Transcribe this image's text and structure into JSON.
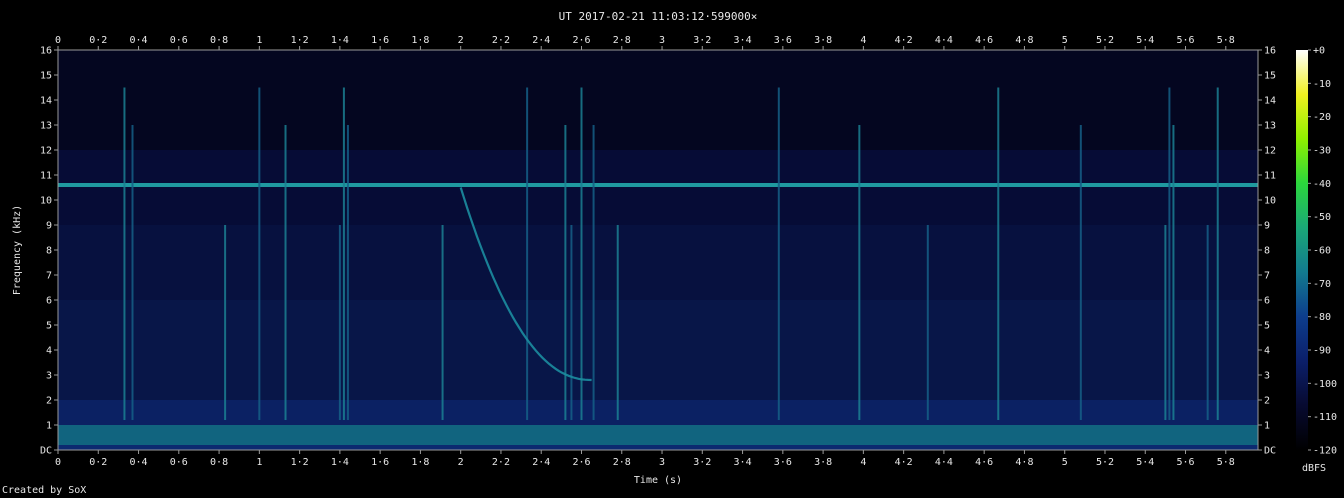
{
  "chart_data": {
    "type": "heatmap",
    "title": "UT 2017-02-21 11:03:12·599000×",
    "xlabel": "Time (s)",
    "ylabel": "Frequency (kHz)",
    "colorbar_label": "dBFS",
    "xlim": [
      0,
      5.96
    ],
    "ylim": [
      0,
      16
    ],
    "x_ticks": [
      "0",
      "0·2",
      "0·4",
      "0·6",
      "0·8",
      "1",
      "1·2",
      "1·4",
      "1·6",
      "1·8",
      "2",
      "2·2",
      "2·4",
      "2·6",
      "2·8",
      "3",
      "3·2",
      "3·4",
      "3·6",
      "3·8",
      "4",
      "4·2",
      "4·4",
      "4·6",
      "4·8",
      "5",
      "5·2",
      "5·4",
      "5·6",
      "5·8"
    ],
    "y_ticks": [
      "DC",
      "1",
      "2",
      "3",
      "4",
      "5",
      "6",
      "7",
      "8",
      "9",
      "10",
      "11",
      "12",
      "13",
      "14",
      "15",
      "16"
    ],
    "colorbar_ticks": [
      "+0",
      "-10",
      "-20",
      "-30",
      "-40",
      "-50",
      "-60",
      "-70",
      "-80",
      "-90",
      "-100",
      "-110",
      "-120"
    ],
    "zlim": [
      -120,
      0
    ],
    "colormap": [
      "#000000",
      "#070a30",
      "#0b1f6a",
      "#0d3d8c",
      "#127a8f",
      "#1aa877",
      "#2bd63c",
      "#8ff000",
      "#f0f020",
      "#ffffff"
    ],
    "features": {
      "hum_line_khz": 10.6,
      "low_band_khz": [
        0.2,
        1.0
      ],
      "impulses_s": [
        0.33,
        0.37,
        0.83,
        1.0,
        1.13,
        1.4,
        1.42,
        1.44,
        1.91,
        2.33,
        2.52,
        2.55,
        2.6,
        2.66,
        2.78,
        3.58,
        3.98,
        4.32,
        4.67,
        5.08,
        5.5,
        5.52,
        5.54,
        5.71,
        5.76
      ],
      "chirp": {
        "t_start_s": 2.0,
        "t_end_s": 2.65,
        "f_start_khz": 10.5,
        "f_end_khz": 2.8
      }
    }
  },
  "credit": "Created by SoX"
}
